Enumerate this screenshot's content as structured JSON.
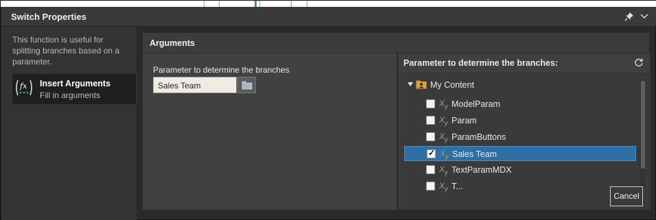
{
  "window": {
    "title": "Switch Properties"
  },
  "sidebar": {
    "description": "This function is useful for splitting branches based on a parameter.",
    "insert_item": {
      "title": "Insert Arguments",
      "subtitle": "Fill in arguments",
      "icon": "fx-function-icon"
    }
  },
  "main": {
    "section_title": "Arguments",
    "param_label": "Parameter to determine the branches",
    "param_value": "Sales Team",
    "picker": {
      "title": "Parameter to determine the branches:",
      "root": {
        "label": "My Content",
        "icon": "user-folder-icon",
        "expanded": true
      },
      "items": [
        {
          "label": "ModelParam",
          "checked": false,
          "selected": false
        },
        {
          "label": "Param",
          "checked": false,
          "selected": false
        },
        {
          "label": "ParamButtons",
          "checked": false,
          "selected": false
        },
        {
          "label": "Sales Team",
          "checked": true,
          "selected": true
        },
        {
          "label": "TextParamMDX",
          "checked": false,
          "selected": false
        },
        {
          "label": "T...",
          "checked": false,
          "selected": false
        }
      ]
    }
  },
  "buttons": {
    "cancel": "Cancel"
  },
  "colors": {
    "selected_row": "#2f6fa5",
    "accent_folder": "#d9a23a"
  }
}
